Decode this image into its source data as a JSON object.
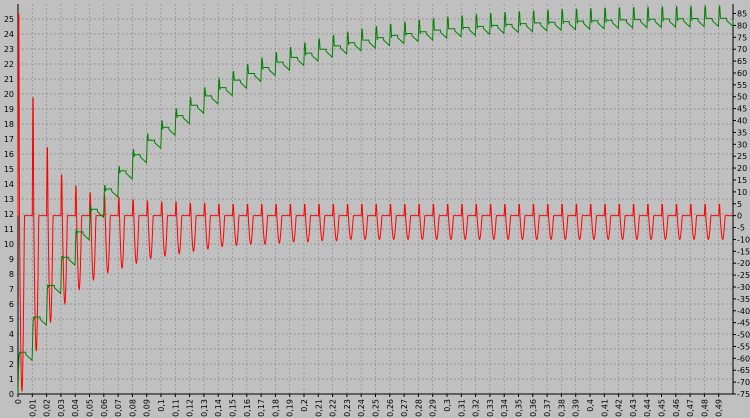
{
  "chart_data": {
    "type": "line",
    "title": "",
    "xlabel": "",
    "ylabel": "",
    "grid": true,
    "colors": {
      "background": "#c0c0c0",
      "grid": "#8c8c8c",
      "series_red": "#ff0000",
      "series_green": "#008000"
    },
    "x_range": [
      0,
      0.5
    ],
    "x_ticks": [
      "0",
      "0,01",
      "0,02",
      "0,03",
      "0,04",
      "0,05",
      "0,06",
      "0,07",
      "0,08",
      "0,09",
      "0,1",
      "0,11",
      "0,12",
      "0,13",
      "0,14",
      "0,15",
      "0,16",
      "0,17",
      "0,18",
      "0,19",
      "0,2",
      "0,21",
      "0,22",
      "0,23",
      "0,24",
      "0,25",
      "0,26",
      "0,27",
      "0,28",
      "0,29",
      "0,3",
      "0,31",
      "0,32",
      "0,33",
      "0,34",
      "0,35",
      "0,36",
      "0,37",
      "0,38",
      "0,39",
      "0,4",
      "0,41",
      "0,42",
      "0,43",
      "0,44",
      "0,45",
      "0,46",
      "0,47",
      "0,48",
      "0,49"
    ],
    "y_left_range": [
      0,
      26
    ],
    "y_left_ticks": [
      "0",
      "1",
      "2",
      "3",
      "4",
      "5",
      "6",
      "7",
      "8",
      "9",
      "10",
      "11",
      "12",
      "13",
      "14",
      "15",
      "16",
      "17",
      "18",
      "19",
      "20",
      "21",
      "22",
      "23",
      "24",
      "25"
    ],
    "y_right_range": [
      -75,
      89
    ],
    "y_right_ticks": [
      "-75",
      "-70",
      "-65",
      "-60",
      "-55",
      "-50",
      "-45",
      "-40",
      "-35",
      "-30",
      "-25",
      "-20",
      "-15",
      "-10",
      "-5",
      "0",
      "5",
      "10",
      "15",
      "20",
      "25",
      "30",
      "35",
      "40",
      "45",
      "50",
      "55",
      "60",
      "65",
      "70",
      "75",
      "80",
      "85"
    ],
    "series": [
      {
        "axis": "right",
        "style": "oscillating pulses, damped",
        "period": 0.01,
        "baseline": 0,
        "peaks_right_axis": [
          89,
          52,
          30,
          18,
          13,
          10,
          9,
          8,
          7,
          6.5,
          6,
          6,
          5.5,
          5.5,
          5,
          5,
          5,
          5,
          5,
          5,
          5,
          5,
          5,
          5,
          5,
          5,
          5,
          5,
          5,
          5,
          5,
          5,
          5,
          5,
          5,
          5,
          5,
          5,
          5,
          5,
          5,
          5,
          5,
          5,
          5,
          5,
          5,
          5,
          5,
          5
        ],
        "troughs_right_axis": [
          -74,
          -57,
          -45,
          -37,
          -31,
          -27,
          -24,
          -22,
          -20,
          -18,
          -17,
          -16,
          -15,
          -14,
          -13,
          -12.5,
          -12,
          -12,
          -11.5,
          -11,
          -11,
          -10.5,
          -10.5,
          -10,
          -10,
          -10,
          -10,
          -10,
          -10,
          -10,
          -10,
          -10,
          -10,
          -10,
          -10,
          -10,
          -10,
          -10,
          -10,
          -10,
          -10,
          -10,
          -10,
          -10,
          -10,
          -10,
          -10,
          -10,
          -10,
          -10
        ]
      },
      {
        "axis": "left",
        "style": "stepped rise with periodic spikes",
        "period": 0.01,
        "start": 0,
        "final": 25,
        "time_constant": 0.09,
        "spike_height": 1
      }
    ]
  }
}
